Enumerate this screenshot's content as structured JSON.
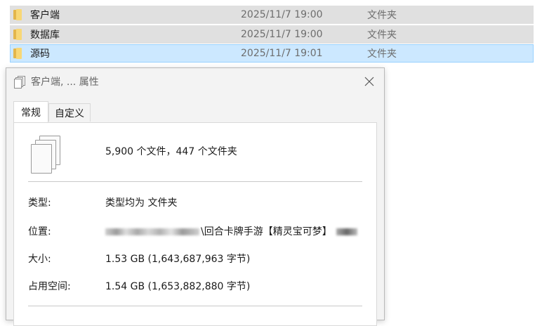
{
  "explorer": {
    "rows": [
      {
        "name": "客户端",
        "date": "2025/11/7 19:00",
        "type": "文件夹"
      },
      {
        "name": "数据库",
        "date": "2025/11/7 19:00",
        "type": "文件夹"
      },
      {
        "name": "源码",
        "date": "2025/11/7 19:01",
        "type": "文件夹"
      }
    ]
  },
  "dialog": {
    "title": "客户端, ... 属性",
    "tabs": [
      {
        "label": "常规"
      },
      {
        "label": "自定义"
      }
    ],
    "summary": "5,900 个文件，447 个文件夹",
    "props": {
      "type_label": "类型:",
      "type_value": "类型均为 文件夹",
      "location_label": "位置:",
      "location_value": "\\回合卡牌手游【精灵宝可梦】",
      "size_label": "大小:",
      "size_value": "1.53 GB (1,643,687,963 字节)",
      "disk_label": "占用空间:",
      "disk_value": "1.54 GB (1,653,882,880 字节)"
    }
  },
  "colors": {
    "selected_bg": "#cce8ff",
    "selected_border": "#99d1ff",
    "gray_row_bg": "#e0e0e0"
  },
  "icons": {
    "folder": "folder-icon",
    "dialog_title": "multiple-files-icon",
    "close": "close-icon",
    "files": "multiple-files-icon"
  }
}
